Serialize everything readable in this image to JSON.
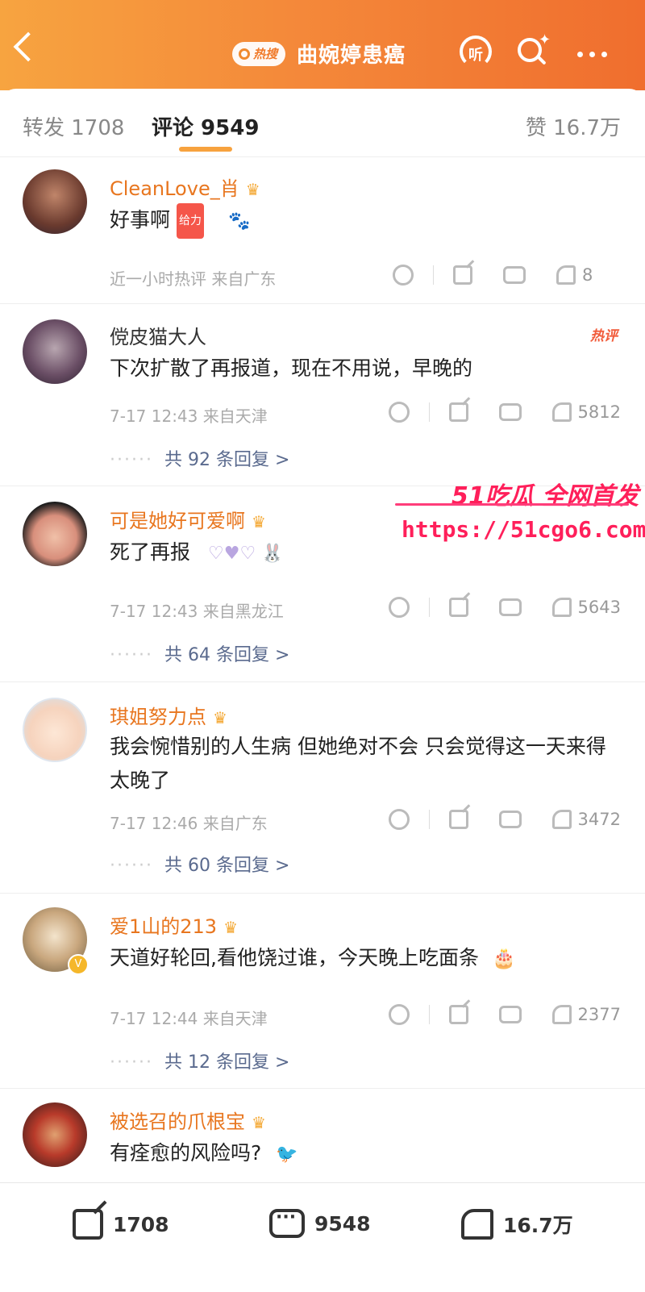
{
  "header": {
    "hot_badge": "热搜",
    "title": "曲婉婷患癌",
    "listen_label": "听"
  },
  "tabs": {
    "forward": "转发 1708",
    "comment": "评论 9549",
    "like": "赞 16.7万"
  },
  "comments": [
    {
      "user": "CleanLove_肖",
      "text": "好事啊",
      "emoji": "给力",
      "meta": "近一小时热评  来自广东",
      "likes": "8",
      "reply": "",
      "hot": ""
    },
    {
      "user": "傥皮猫大人",
      "text": "下次扩散了再报道，现在不用说，早晚的",
      "meta": "7-17 12:43  来自天津",
      "likes": "5812",
      "reply": "共 92 条回复 >",
      "hot": "热评"
    },
    {
      "user": "可是她好可爱啊",
      "text": "死了再报",
      "meta": "7-17 12:43  来自黑龙江",
      "likes": "5643",
      "reply": "共 64 条回复 >",
      "hot": ""
    },
    {
      "user": "琪姐努力点",
      "text": "我会惋惜别的人生病 但她绝对不会  只会觉得这一天来得太晚了",
      "meta": "7-17 12:46  来自广东",
      "likes": "3472",
      "reply": "共 60 条回复 >",
      "hot": ""
    },
    {
      "user": "爱1山的213",
      "text": "天道好轮回,看他饶过谁，今天晚上吃面条",
      "meta": "7-17 12:44  来自天津",
      "likes": "2377",
      "reply": "共 12 条回复 >",
      "hot": ""
    },
    {
      "user": "被选召的爪根宝",
      "text": "有痊愈的风险吗?",
      "meta": "",
      "likes": "",
      "reply": "",
      "hot": ""
    }
  ],
  "watermark": {
    "line1": "51吃瓜 全网首发",
    "line2": "https://51cgo6.com"
  },
  "bottom": {
    "forward": "1708",
    "comment": "9548",
    "like": "16.7万"
  },
  "colors": {
    "header_start": "#f7a440",
    "header_end": "#f06e2e",
    "username": "#e8761f",
    "reply_link": "#5a6a8e",
    "watermark": "#ff1f5a"
  }
}
